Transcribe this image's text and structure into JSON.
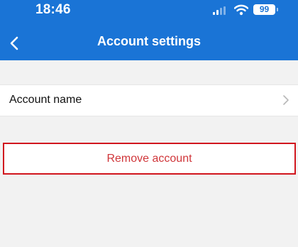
{
  "status_bar": {
    "time": "18:46",
    "battery": "99",
    "icons": [
      "signal-icon",
      "wifi-icon",
      "battery-icon"
    ]
  },
  "header": {
    "title": "Account settings",
    "back_icon": "chevron-left-icon"
  },
  "settings": {
    "account_name_label": "Account name",
    "row_icon": "chevron-right-icon"
  },
  "actions": {
    "remove_account_label": "Remove account"
  },
  "colors": {
    "header_bg": "#1a74d6",
    "page_bg": "#f2f2f2",
    "destructive": "#d0363a",
    "highlight_border": "#d1161e"
  }
}
